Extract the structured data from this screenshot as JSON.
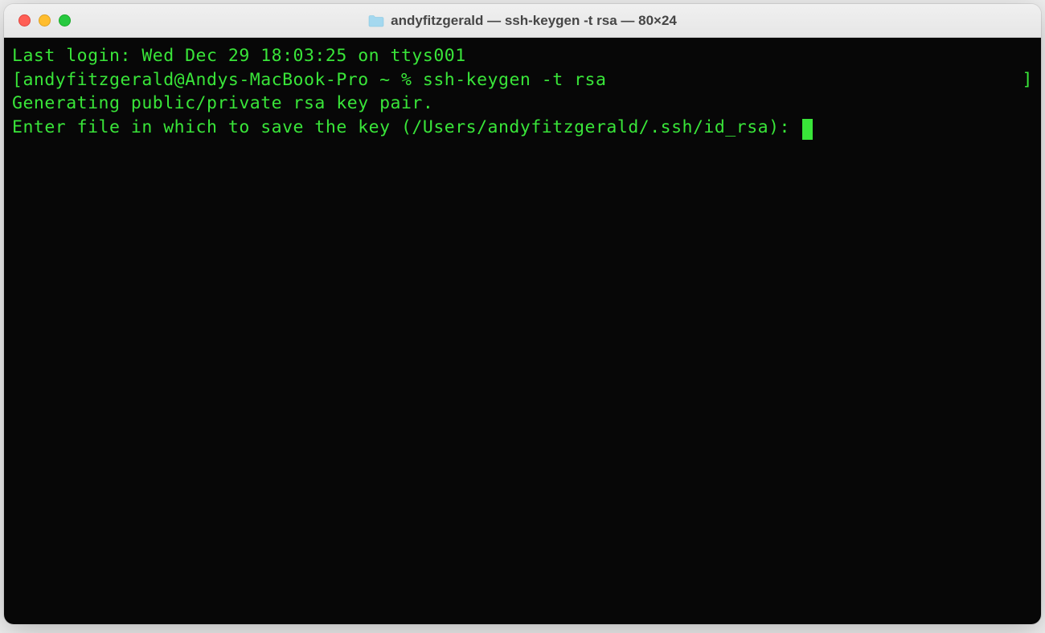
{
  "window": {
    "title": "andyfitzgerald — ssh-keygen -t rsa — 80×24"
  },
  "terminal": {
    "last_login": "Last login: Wed Dec 29 18:03:25 on ttys001",
    "prompt_open_bracket": "[",
    "prompt_text": "andyfitzgerald@Andys-MacBook-Pro ~ % ",
    "command": "ssh-keygen -t rsa",
    "prompt_close_bracket": "]",
    "output_line1": "Generating public/private rsa key pair.",
    "output_line2": "Enter file in which to save the key (/Users/andyfitzgerald/.ssh/id_rsa): "
  },
  "colors": {
    "terminal_bg": "#070707",
    "terminal_fg": "#39e539"
  }
}
